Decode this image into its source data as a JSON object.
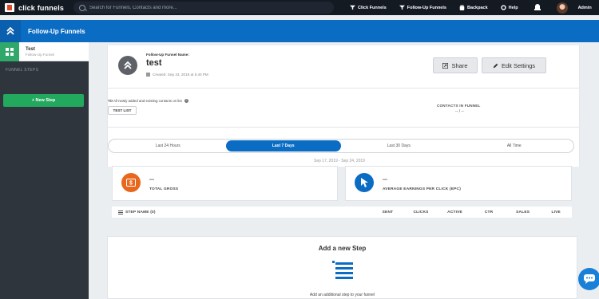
{
  "topbar": {
    "brand": "click funnels",
    "search_placeholder": "Search for Funnels, Contacts and more...",
    "nav": [
      {
        "label": "Click Funnels",
        "icon": "funnel-icon"
      },
      {
        "label": "Follow-Up Funnels",
        "icon": "follow-up-icon"
      },
      {
        "label": "Backpack",
        "icon": "backpack-icon"
      },
      {
        "label": "Help",
        "icon": "gear-icon"
      }
    ],
    "user": "Admin"
  },
  "header": {
    "title": "Follow-Up Funnels"
  },
  "sidebar": {
    "funnel_name": "Test",
    "funnel_type": "Follow-Up Funnel",
    "steps_label": "FUNNEL STEPS",
    "new_step_label": "+ New Step"
  },
  "funnel": {
    "name_label": "Follow-Up Funnel Name:",
    "name": "test",
    "created": "Created: Sep 23, 2019 at 5:40 PM",
    "share_label": "Share",
    "edit_label": "Edit Settings",
    "to_prefix": "TO",
    "to_text": "All newly added and existing contacts on list",
    "list_name": "TEST LIST",
    "contacts_label": "CONTACTS IN FUNNEL",
    "contacts_value": "-- / --"
  },
  "tabs": [
    "Last 24 Hours",
    "Last 7 Days",
    "Last 30 Days",
    "All Time"
  ],
  "active_tab": 1,
  "date_range": "Sep 17, 2019 - Sep 24, 2019",
  "stats": [
    {
      "value": "---",
      "label": "TOTAL GROSS",
      "color": "#e8671d",
      "icon": "dollar-icon"
    },
    {
      "value": "---",
      "label": "AVERAGE EARNINGS PER CLICK (EPC)",
      "color": "#0b6cc4",
      "icon": "cursor-icon"
    }
  ],
  "table": {
    "step_name": "STEP NAME (0)",
    "columns": [
      "SENT",
      "CLICKS",
      "ACTIVE",
      "CTR",
      "SALES",
      "LIVE"
    ]
  },
  "add_step": {
    "title": "Add a new Step",
    "subtitle": "Add an additional step to your funnel"
  },
  "colors": {
    "brand_blue": "#0b6cc4",
    "green": "#23a95e",
    "dark": "#141a22"
  }
}
